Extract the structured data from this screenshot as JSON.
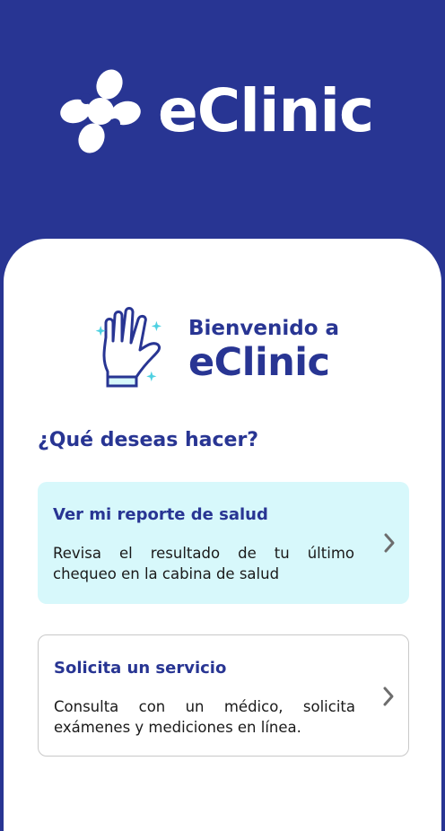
{
  "header": {
    "brand_name": "eClinic",
    "logo_icon": "clinic-cross-logo-icon",
    "background_color": "#283593"
  },
  "welcome": {
    "line1": "Bienvenido a",
    "line2": "eClinic",
    "icon": "waving-hand-icon"
  },
  "question": "¿Qué deseas hacer?",
  "options": [
    {
      "title": "Ver mi reporte de salud",
      "description": "Revisa el resultado de tu último chequeo en la cabina de salud",
      "icon": "chevron-right-icon",
      "background_color": "#d7f8fb"
    },
    {
      "title": "Solicita un servicio",
      "description": "Consulta con un médico, solicita exámenes y mediciones en línea.",
      "icon": "chevron-right-icon",
      "background_color": "#ffffff"
    }
  ],
  "colors": {
    "primary": "#283593",
    "accent_light": "#4dd0e1"
  }
}
